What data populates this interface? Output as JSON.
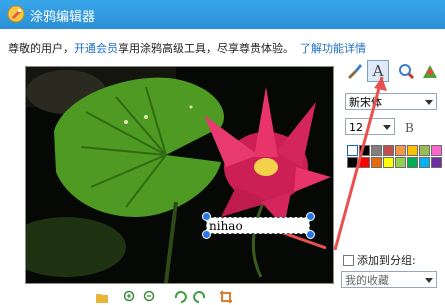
{
  "window": {
    "title": "涂鸦编辑器"
  },
  "notice": {
    "prefix": "尊敬的用户，",
    "link": "开通会员",
    "middle": "享用涂鸦高级工具，尽享尊贵体验。",
    "info_link": "了解功能详情"
  },
  "canvas": {
    "text_value": "nihao"
  },
  "tools": [
    {
      "icon": "brush-icon"
    },
    {
      "icon": "text-icon",
      "label": "A",
      "selected": true
    },
    {
      "icon": "magnifier-icon"
    },
    {
      "icon": "stamp-icon"
    }
  ],
  "font": {
    "family": "新宋体",
    "size": "12",
    "bold_label": "B"
  },
  "palette": [
    "#ffffff",
    "#000000",
    "#808080",
    "#c0504d",
    "#f79646",
    "#ffc000",
    "#9bbb59",
    "#ff0000",
    "#e36c09",
    "#ffff00",
    "#92d050",
    "#00b050",
    "#00b0f0",
    "#0070c0",
    "#7030a0",
    "#ff66cc",
    "#ff00ff"
  ],
  "group": {
    "label": "添加到分组:",
    "selected": "我的收藏"
  },
  "colors": {
    "titlebar": "#2b8fd6",
    "link": "#1a6fc9",
    "annotation_arrow": "#e8514f"
  }
}
